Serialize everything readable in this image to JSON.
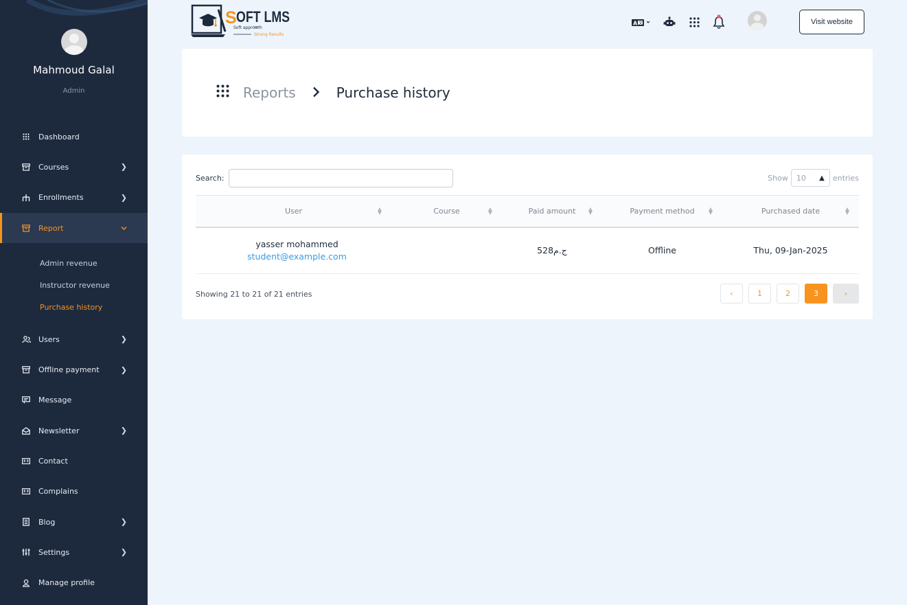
{
  "profile": {
    "name": "Mahmoud Galal",
    "role": "Admin"
  },
  "sidebar": {
    "items": [
      {
        "label": "Dashboard",
        "icon": "dashboard-grid-icon",
        "has_chevron": false
      },
      {
        "label": "Courses",
        "icon": "archive-icon",
        "has_chevron": true
      },
      {
        "label": "Enrollments",
        "icon": "hierarchy-icon",
        "has_chevron": true
      },
      {
        "label": "Report",
        "icon": "archive-icon",
        "has_chevron": true,
        "expanded": true
      },
      {
        "label": "Users",
        "icon": "users-icon",
        "has_chevron": true
      },
      {
        "label": "Offline payment",
        "icon": "archive-icon",
        "has_chevron": true
      },
      {
        "label": "Message",
        "icon": "message-icon",
        "has_chevron": false
      },
      {
        "label": "Newsletter",
        "icon": "envelope-icon",
        "has_chevron": true
      },
      {
        "label": "Contact",
        "icon": "id-card-icon",
        "has_chevron": false
      },
      {
        "label": "Complains",
        "icon": "id-card-icon",
        "has_chevron": false
      },
      {
        "label": "Blog",
        "icon": "document-icon",
        "has_chevron": true
      },
      {
        "label": "Settings",
        "icon": "sliders-icon",
        "has_chevron": true
      },
      {
        "label": "Manage profile",
        "icon": "user-icon",
        "has_chevron": false
      }
    ],
    "report_sub": [
      "Admin revenue",
      "Instructor revenue",
      "Purchase history"
    ]
  },
  "logo": {
    "text": "OFT LMS",
    "s": "S",
    "tagline1": "Soft approach",
    "tagline2": "Strong Results"
  },
  "topbar": {
    "visit_label": "Visit website"
  },
  "breadcrumb": {
    "parent": "Reports",
    "current": "Purchase history"
  },
  "table": {
    "search_label": "Search:",
    "search_value": "",
    "show_label": "Show",
    "show_value": "10",
    "entries_label": "entries",
    "columns": [
      "User",
      "Course",
      "Paid amount",
      "Payment method",
      "Purchased date"
    ],
    "rows": [
      {
        "user_name": "yasser mohammed",
        "user_email": "student@example.com",
        "course": "",
        "paid": "528ج.م",
        "method": "Offline",
        "date": "Thu, 09-Jan-2025"
      }
    ],
    "info": "Showing 21 to 21 of 21 entries",
    "pages": [
      "1",
      "2",
      "3"
    ],
    "current_page": "3",
    "prev": "‹",
    "next": "›"
  },
  "colors": {
    "accent": "#f7931e",
    "sidebar_bg": "#1d2a3e",
    "link": "#3b9ae1",
    "page_bg": "#eef4fb"
  }
}
